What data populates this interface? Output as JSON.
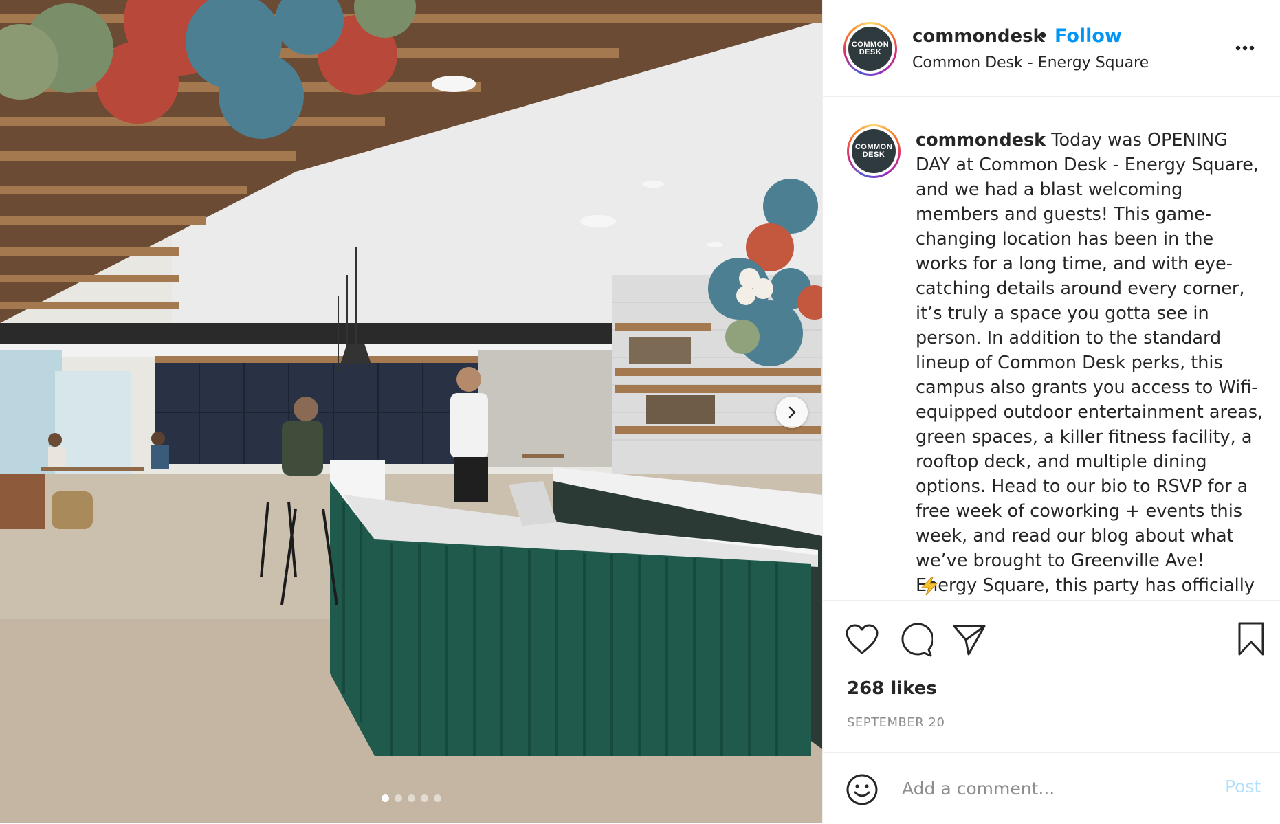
{
  "post": {
    "username": "commondesk",
    "separator": "•",
    "follow_label": "Follow",
    "location": "Common Desk - Energy Square",
    "avatar_text_line1": "COMMON",
    "avatar_text_line2": "DESK",
    "more_icon": "more-horizontal-icon"
  },
  "caption": {
    "username": "commondesk",
    "text": "Today was OPENING DAY at Common Desk - Energy Square, and we had a blast welcoming members and guests! This game-changing location has been in the works for a long time, and with eye-catching details around every corner, it’s truly a space you gotta see in person. In addition to the standard lineup of Common Desk perks, this campus also grants you access to Wifi-equipped outdoor entertainment areas, green spaces, a killer fitness facility, a rooftop deck, and multiple dining options. Head to our bio to RSVP for a free week of coworking + events this week, and read our blog about what we’ve brought to Greenville Ave! Energy Square, this party has officially started",
    "emoji": "lightning-bolt-emoji"
  },
  "actions": {
    "likes": "268 likes",
    "date": "SEPTEMBER 20",
    "icons": [
      "heart-icon",
      "comment-icon",
      "share-icon",
      "bookmark-icon"
    ]
  },
  "comment": {
    "placeholder": "Add a comment...",
    "post_label": "Post"
  },
  "carousel": {
    "total": 5,
    "active_index": 0
  },
  "colors": {
    "link_blue": "#0095f6",
    "post_disabled": "#b2dffc",
    "muted_gray": "#8e8e8e",
    "counter_green": "#1f5a4c"
  }
}
